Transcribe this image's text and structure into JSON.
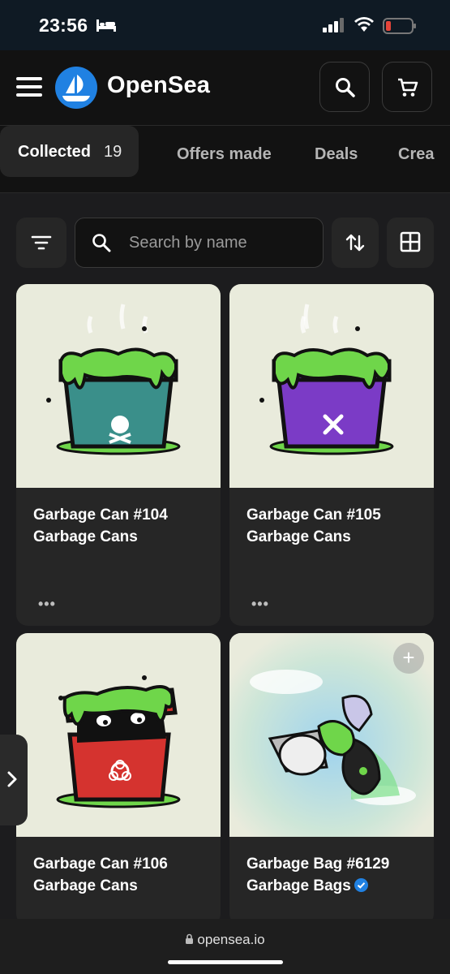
{
  "status_bar": {
    "time": "23:56",
    "icons": [
      "bed-icon",
      "cellular-signal-icon",
      "wifi-icon",
      "battery-low-icon"
    ]
  },
  "header": {
    "brand": "OpenSea",
    "brand_color": "#2081e2",
    "icons": [
      "menu-icon",
      "opensea-logo",
      "search-icon",
      "cart-icon"
    ]
  },
  "tabs": [
    {
      "label": "Collected",
      "count": "19",
      "active": true
    },
    {
      "label": "Offers made"
    },
    {
      "label": "Deals"
    },
    {
      "label": "Crea"
    }
  ],
  "toolbar": {
    "search_placeholder": "Search by name",
    "icons": [
      "filter-icon",
      "search-icon",
      "sort-icon",
      "grid-view-icon"
    ]
  },
  "items": [
    {
      "title": "Garbage Can #104",
      "collection": "Garbage Cans",
      "menu": "•••",
      "art_color": "#3a8f8a"
    },
    {
      "title": "Garbage Can #105",
      "collection": "Garbage Cans",
      "menu": "•••",
      "art_color": "#7b3bc6"
    },
    {
      "title": "Garbage Can #106",
      "collection": "Garbage Cans",
      "art_color": "#d5332f"
    },
    {
      "title": "Garbage Bag #6129",
      "collection": "Garbage Bags",
      "verified": true,
      "add_label": "+"
    }
  ],
  "side_tab": {
    "icon": "chevron-right-icon"
  },
  "url_bar": {
    "url": "opensea.io",
    "icon": "lock-icon"
  }
}
